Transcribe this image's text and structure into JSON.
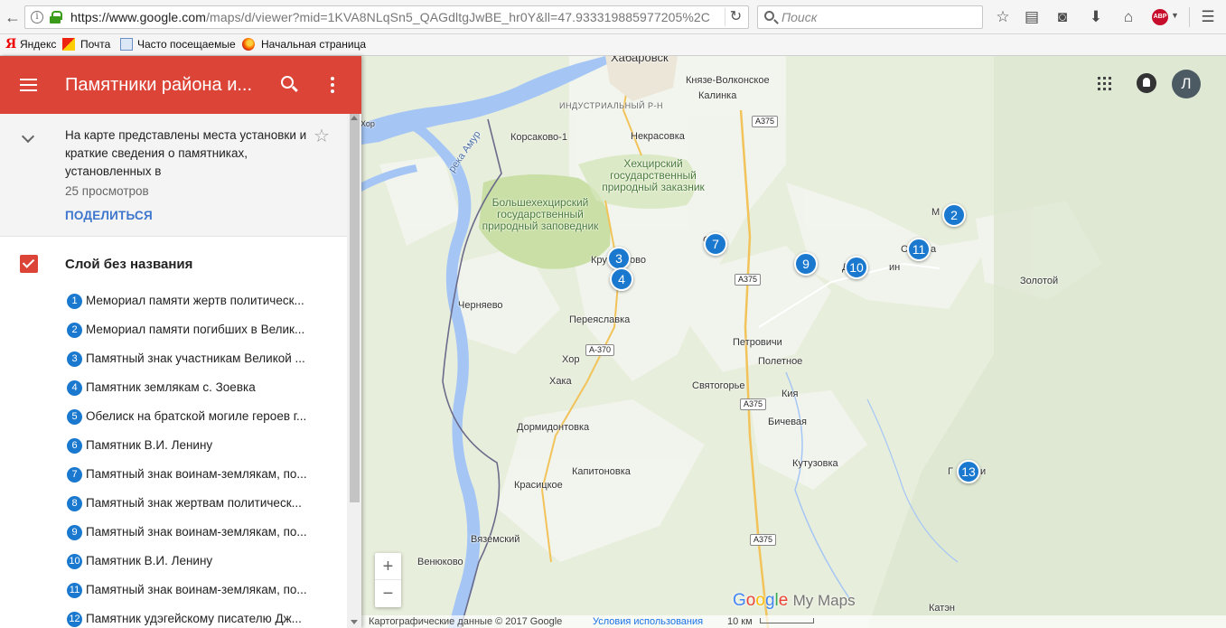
{
  "browser": {
    "url_main": "https://www.google.com",
    "url_rest": "/maps/d/viewer?mid=1KVA8NLqSn5_QAGdltgJwBE_hr0Y&ll=47.933319885977205%2C",
    "search_placeholder": "Поиск",
    "abp_label": "ABP",
    "bookmarks": [
      "Яндекс",
      "Почта",
      "Часто посещаемые",
      "Начальная страница"
    ]
  },
  "panel": {
    "title": "Памятники района и...",
    "description": "На карте представлены места установки и краткие сведения о памятниках, установленных в",
    "views": "25 просмотров",
    "share_label": "ПОДЕЛИТЬСЯ",
    "layer_title": "Слой без названия",
    "items": [
      {
        "num": "1",
        "label": "Мемориал памяти жертв политическ..."
      },
      {
        "num": "2",
        "label": "Мемориал памяти погибших в Велик..."
      },
      {
        "num": "3",
        "label": "Памятный знак участникам Великой ..."
      },
      {
        "num": "4",
        "label": "Памятник землякам с. Зоевка"
      },
      {
        "num": "5",
        "label": "Обелиск на братской могиле героев г..."
      },
      {
        "num": "6",
        "label": "Памятник В.И. Ленину"
      },
      {
        "num": "7",
        "label": "Памятный знак воинам-землякам, по..."
      },
      {
        "num": "8",
        "label": "Памятный знак жертвам политическ..."
      },
      {
        "num": "9",
        "label": "Памятный знак воинам-землякам, по..."
      },
      {
        "num": "10",
        "label": "Памятник В.И. Ленину"
      },
      {
        "num": "11",
        "label": "Памятный знак воинам-землякам, по..."
      },
      {
        "num": "12",
        "label": "Памятник удэгейскому писателю Дж..."
      }
    ]
  },
  "map": {
    "labels": {
      "khabarovsk": "Хабаровск",
      "knyaze": "Князе-Волконское",
      "kalinka": "Калинка",
      "industrial": "ИНДУСТРИАЛЬНЫЙ Р-Н",
      "korsakovo": "Корсаково-1",
      "nekrasovka": "Некрасовка",
      "amur": "река Амур",
      "khekhtsir": "Хехцирский государственный природный заказник",
      "bolshekhekh": "Большехехцирский государственный природный заповедник",
      "kru": "Кру",
      "ovo": "ово",
      "chernyaevo": "Черняево",
      "pereyaslavka": "Переяславка",
      "khor": "Хор",
      "khaka": "Хака",
      "dormidontovka": "Дормидонтовка",
      "svyatogorye": "Святогорье",
      "petrovichi": "Петровичи",
      "poletnoe": "Полетное",
      "kiya": "Кия",
      "bichevaya": "Бичевая",
      "kutuzovka": "Кутузовка",
      "kapitonovka": "Капитоновка",
      "krasitskoe": "Красицкое",
      "vyazemsky": "Вяземский",
      "venyukovo": "Венюково",
      "zolotoy": "Золотой",
      "dlin": "Д",
      "din": "ин",
      "m": "М",
      "s": "С",
      "c": "С",
      "a": "а",
      "g": "Г",
      "i": "и",
      "katen": "Катэн",
      "khor2": "Хор"
    },
    "shields": [
      "А375",
      "А375",
      "А375",
      "А-370",
      "А375"
    ],
    "pins": [
      "2",
      "3",
      "4",
      "7",
      "9",
      "10",
      "11",
      "13"
    ],
    "avatar_letter": "Л",
    "zoom_in": "+",
    "zoom_out": "−",
    "logo_my_maps": "My Maps",
    "attribution": "Картографические данные © 2017 Google",
    "terms": "Условия использования",
    "scale_label": "10 км"
  },
  "colors": {
    "header_red": "#db4437",
    "pin_blue": "#1a79cf",
    "water": "#a5c6f5",
    "reserve_green": "#c9dfa5"
  }
}
